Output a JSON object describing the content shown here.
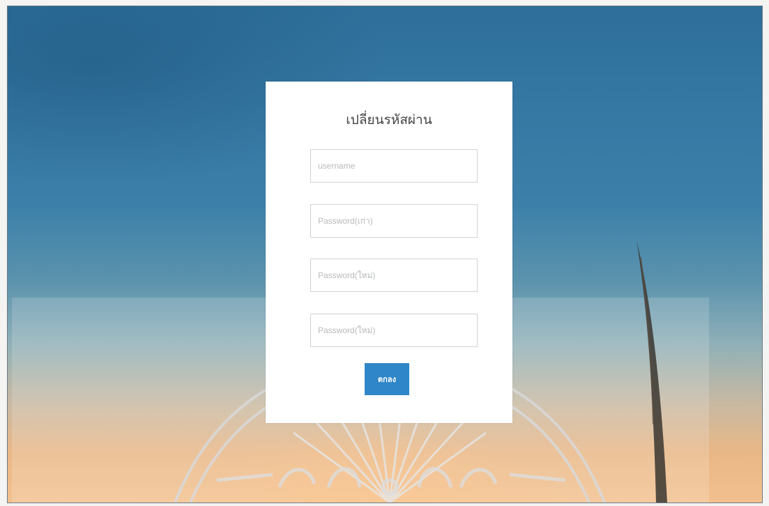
{
  "form": {
    "title": "เปลี่ยนรหัสผ่าน",
    "username_placeholder": "username",
    "old_password_placeholder": "Password(เก่า)",
    "new_password_placeholder": "Password(ใหม่)",
    "confirm_password_placeholder": "Password(ใหม่)",
    "submit_label": "ตกลง"
  },
  "colors": {
    "accent": "#2f86c8",
    "sky_top": "#2d6f9a",
    "sunset": "#f2c08e"
  }
}
